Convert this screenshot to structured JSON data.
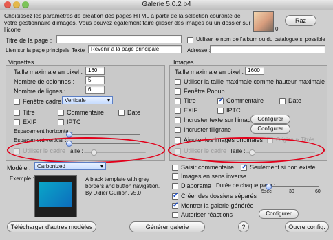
{
  "window": {
    "title": "Galerie 5.0.2 b4"
  },
  "header": {
    "description": "Choisissez les parametres de création des pages HTML à partir de la sélection courante de votre gestionnaire d'images. Vous pouvez également faire glisser des images ou un dossier sur l'icone :",
    "counter": "0",
    "raz_label": "Ràz"
  },
  "page": {
    "title_label": "Titre de la page :",
    "title_value": "",
    "use_album_name_label": "Utiliser le nom de l'album ou du catalogue si possible",
    "link_label": "Lien sur la page principale :",
    "text_label": "Texte :",
    "text_value": "Revenir à la page principale",
    "address_label": "Adresse :",
    "address_value": ""
  },
  "vignettes": {
    "title": "Vignettes",
    "max_size_label": "Taille maximale en pixel :",
    "max_size_value": "160",
    "cols_label": "Nombre de colonnes :",
    "cols_value": "5",
    "rows_label": "Nombre de lignes :",
    "rows_value": "6",
    "frame_window_label": "Fenêtre cadre",
    "frame_orientation_value": "Verticale",
    "title_cb_label": "Titre",
    "comment_cb_label": "Commentaire",
    "date_cb_label": "Date",
    "exif_cb_label": "EXIF",
    "iptc_cb_label": "IPTC",
    "h_spacing_label": "Espacement horizontal :",
    "v_spacing_label": "Espacement vertical :",
    "use_frame_label": "Utiliser le cadre",
    "size_label": "Taille :"
  },
  "model": {
    "label": "Modèle :",
    "value": "Carbonized",
    "example_label": "Exemple :",
    "description": "A black template with grey borders and button navigation. By Didier Guillion. v5.0"
  },
  "images": {
    "title": "Images",
    "max_size_label": "Taille maximale en pixel :",
    "max_size_value": "1600",
    "use_max_height_label": "Utiliser la taille maximale comme hauteur maximale",
    "popup_label": "Fenêtre Popup",
    "title_cb_label": "Titre",
    "comment_cb_label": "Commentaire",
    "date_cb_label": "Date",
    "exif_cb_label": "EXIF",
    "iptc_cb_label": "IPTC",
    "embed_text_label": "Incruster texte sur l'image",
    "embed_watermark_label": "Incruster filigrane",
    "add_originals_label": "Ajouter les images originales",
    "original_titled_label": "Originaux Titrés",
    "use_frame_label": "Utiliser le cadre",
    "size_label": "Taille :",
    "configure_label": "Configurer"
  },
  "options": {
    "input_comment_label": "Saisir commentaire",
    "only_if_not_exists_label": "Seulement si non existe",
    "reverse_images_label": "Images en sens inverse",
    "slideshow_label": "Diaporama",
    "page_duration_label": "Durée de chaque page :",
    "tick_5": "5sec",
    "tick_30": "30",
    "tick_60": "60",
    "separate_folders_label": "Créer des dossiers séparés",
    "show_gallery_label": "Montrer la galerie générée",
    "allow_reactions_label": "Autoriser réactions",
    "configure_label": "Configurer"
  },
  "footer": {
    "download_models_label": "Télécharger d'autres modèles",
    "generate_label": "Générer galerie",
    "help_label": "?",
    "open_config_label": "Ouvre config."
  },
  "colors": {
    "highlight_ellipse": "#e2001a",
    "accent_blue": "#5c7fc4"
  }
}
